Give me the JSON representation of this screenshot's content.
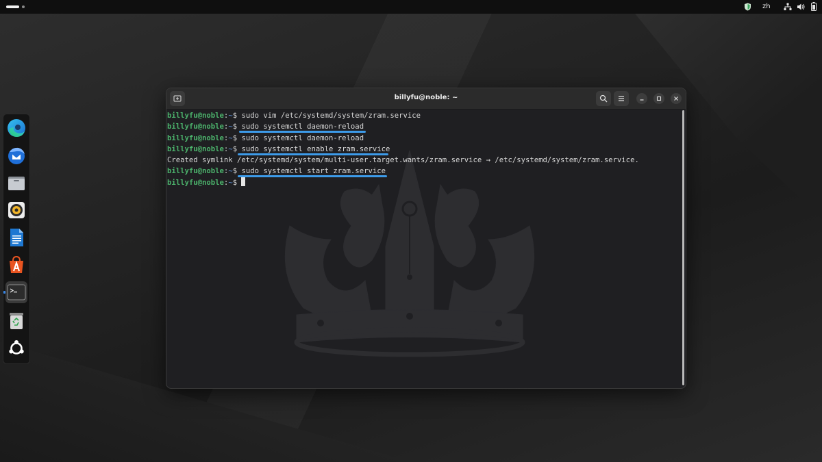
{
  "topbar": {
    "language": "zh"
  },
  "dock": {
    "items": [
      {
        "name": "edge",
        "icon": "edge-browser-icon"
      },
      {
        "name": "thunderbird",
        "icon": "thunderbird-mail-icon"
      },
      {
        "name": "files",
        "icon": "files-folder-icon"
      },
      {
        "name": "rhythmbox",
        "icon": "rhythmbox-speaker-icon"
      },
      {
        "name": "writer",
        "icon": "libreoffice-writer-icon"
      },
      {
        "name": "app-center",
        "icon": "app-center-icon"
      },
      {
        "name": "terminal",
        "icon": "terminal-icon",
        "active": true
      },
      {
        "name": "trash",
        "icon": "trash-icon"
      },
      {
        "name": "show-apps",
        "icon": "ubuntu-logo-icon"
      }
    ]
  },
  "terminal": {
    "title": "billyfu@noble: ~",
    "prompt_user": "billyfu@noble",
    "prompt_sep": ":",
    "prompt_path": "~",
    "prompt_symbol": "$",
    "lines": [
      {
        "type": "cmd",
        "command": "sudo vim /etc/systemd/system/zram.service",
        "highlighted": false
      },
      {
        "type": "cmd",
        "command": "sudo systemctl daemon-reload",
        "highlighted": true
      },
      {
        "type": "cmd",
        "command": "sudo systemctl daemon-reload",
        "highlighted": false
      },
      {
        "type": "cmd",
        "command": "sudo systemctl enable zram.service",
        "highlighted": true
      },
      {
        "type": "output",
        "text": "Created symlink /etc/systemd/system/multi-user.target.wants/zram.service → /etc/systemd/system/zram.service."
      },
      {
        "type": "cmd",
        "command": "sudo systemctl start zram.service",
        "highlighted": true
      },
      {
        "type": "cmd",
        "command": "",
        "highlighted": false,
        "cursor": true
      }
    ],
    "highlight_color": "#3d9be9",
    "prompt_color": "#4cb36c",
    "path_color": "#5d8fd3"
  }
}
